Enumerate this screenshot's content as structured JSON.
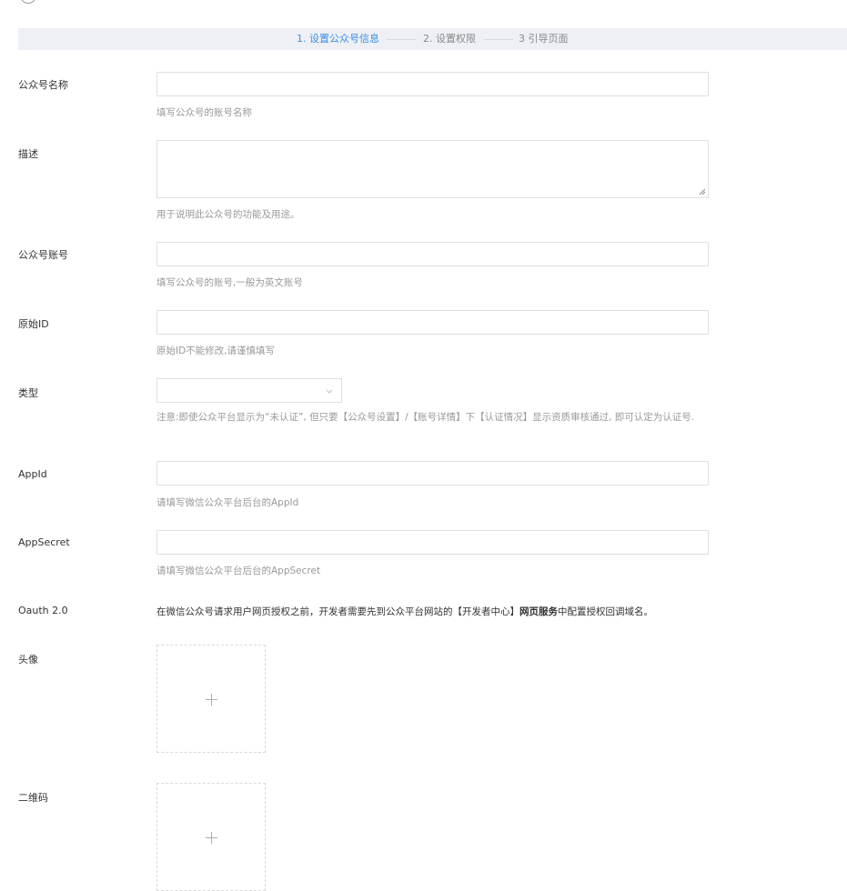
{
  "steps": [
    {
      "label": "1. 设置公众号信息",
      "active": true
    },
    {
      "label": "2. 设置权限",
      "active": false
    },
    {
      "label": "3 引导页面",
      "active": false
    }
  ],
  "form": {
    "name": {
      "label": "公众号名称",
      "value": "",
      "help": "填写公众号的账号名称"
    },
    "description": {
      "label": "描述",
      "value": "",
      "help": "用于说明此公众号的功能及用途。"
    },
    "account": {
      "label": "公众号账号",
      "value": "",
      "help": "填写公众号的账号,一般为英文账号"
    },
    "original_id": {
      "label": "原始ID",
      "value": "",
      "help": "原始ID不能修改,请谨慎填写"
    },
    "type": {
      "label": "类型",
      "value": "",
      "help": "注意:即使公众平台显示为“未认证”, 但只要【公众号设置】/【账号详情】下【认证情况】显示资质审核通过, 即可认定为认证号."
    },
    "appid": {
      "label": "AppId",
      "value": "",
      "help": "请填写微信公众平台后台的AppId"
    },
    "appsecret": {
      "label": "AppSecret",
      "value": "",
      "help": "请填写微信公众平台后台的AppSecret"
    },
    "oauth": {
      "label": "Oauth 2.0",
      "note_prefix": "在微信公众号请求用户网页授权之前，开发者需要先到公众平台网站的【开发者中心】",
      "note_bold": "网页服务",
      "note_suffix": "中配置授权回调域名。"
    },
    "avatar": {
      "label": "头像"
    },
    "qrcode": {
      "label": "二维码"
    }
  },
  "colors": {
    "accent": "#3a8ee6",
    "step_bar": "#eef0f5",
    "border": "#dcdfe6",
    "help_text": "#999999"
  },
  "icons": {
    "select_arrow": "chevron-down-icon",
    "upload": "plus-icon"
  }
}
